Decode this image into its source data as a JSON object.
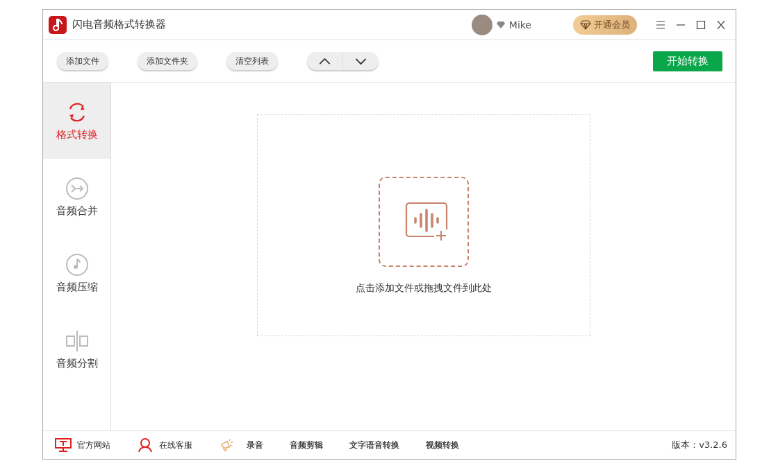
{
  "window": {
    "title": "闪电音频格式转换器"
  },
  "user": {
    "name": "Mike"
  },
  "vip_button": {
    "label": "开通会员"
  },
  "toolbar": {
    "buttons": [
      "添加文件",
      "添加文件夹",
      "清空列表"
    ],
    "start_button": "开始转换"
  },
  "sidebar": {
    "items": [
      {
        "kind": "convert",
        "label": "格式转换",
        "selected": true
      },
      {
        "kind": "merge",
        "label": "音频合并",
        "selected": false
      },
      {
        "kind": "compress",
        "label": "音频压缩",
        "selected": false
      },
      {
        "kind": "split",
        "label": "音频分割",
        "selected": false
      }
    ]
  },
  "drop_zone": {
    "hint": "点击添加文件或拖拽文件到此处"
  },
  "footer": {
    "links": [
      {
        "kind": "website",
        "label": "官方网站"
      },
      {
        "kind": "support",
        "label": "在线客服"
      },
      {
        "kind": "record",
        "label": "录音"
      },
      {
        "kind": "plain",
        "label": "音频剪辑"
      },
      {
        "kind": "plain",
        "label": "文字语音转换"
      },
      {
        "kind": "plain",
        "label": "视频转换"
      }
    ],
    "version": "版本：v3.2.6"
  }
}
